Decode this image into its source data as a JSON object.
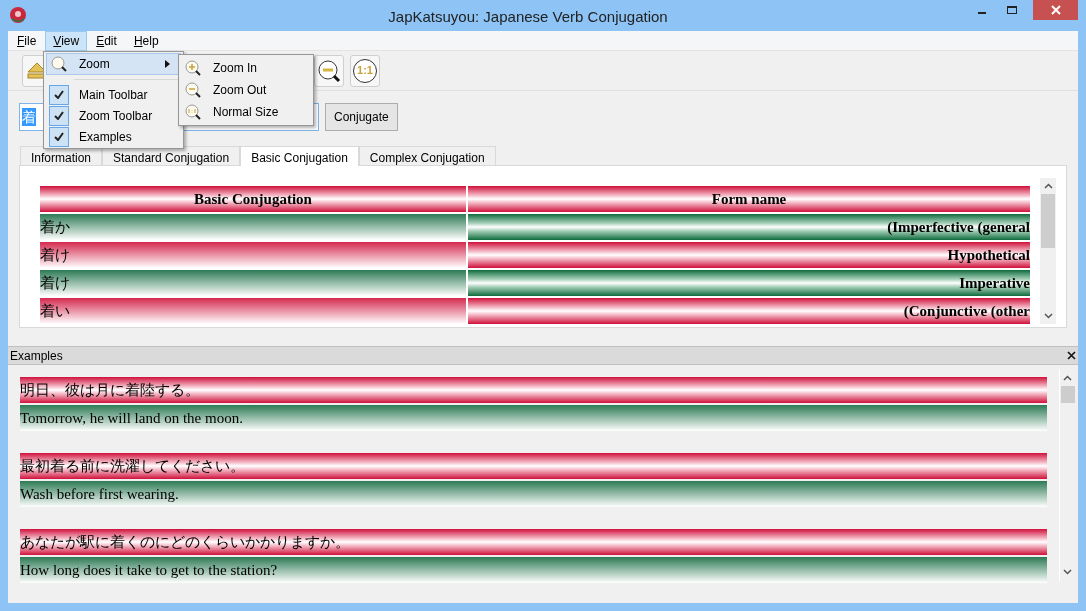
{
  "window": {
    "title": "JapKatsuyou: Japanese Verb Conjugation"
  },
  "menu": [
    {
      "label": "File",
      "selected": false
    },
    {
      "label": "View",
      "selected": true
    },
    {
      "label": "Edit",
      "selected": false
    },
    {
      "label": "Help",
      "selected": false
    }
  ],
  "view_menu": [
    {
      "kind": "submenu",
      "label": "Zoom",
      "selected": true
    },
    {
      "kind": "check",
      "label": "Main Toolbar",
      "checked": true
    },
    {
      "kind": "check",
      "label": "Zoom Toolbar",
      "checked": true
    },
    {
      "kind": "check",
      "label": "Examples",
      "checked": true
    }
  ],
  "zoom_submenu": [
    {
      "kind": "in",
      "label": "Zoom In"
    },
    {
      "kind": "out",
      "label": "Zoom Out"
    },
    {
      "kind": "normal",
      "label": "Normal Size"
    }
  ],
  "toolbar": {
    "normal_size_label": "1:1"
  },
  "verb_input": {
    "value": "着"
  },
  "conjugate_button": "Conjugate",
  "tabs": [
    {
      "label": "Information",
      "selected": false
    },
    {
      "label": "Standard Conjugation",
      "selected": false
    },
    {
      "label": "Basic Conjugation",
      "selected": true
    },
    {
      "label": "Complex Conjugation",
      "selected": false
    }
  ],
  "table": {
    "columns": [
      "Basic Conjugation",
      "Form name"
    ],
    "rows": [
      {
        "form": "着か",
        "name": "(Imperfective (general"
      },
      {
        "form": "着け",
        "name": "Hypothetical"
      },
      {
        "form": "着け",
        "name": "Imperative"
      },
      {
        "form": "着い",
        "name": "(Conjunctive (other"
      }
    ]
  },
  "examples": {
    "title": "Examples",
    "items": [
      {
        "japanese": "明日、彼は月に着陸する。",
        "english": "Tomorrow, he will land on the moon."
      },
      {
        "japanese": "最初着る前に洗濯してください。",
        "english": "Wash before first wearing."
      },
      {
        "japanese": "あなたが駅に着くのにどのくらいかかりますか。",
        "english": "How long does it take to get to the station?"
      }
    ]
  }
}
